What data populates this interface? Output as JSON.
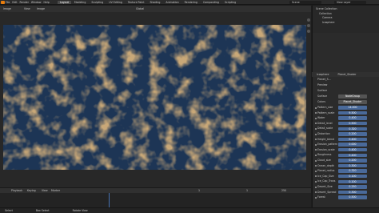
{
  "menu": {
    "items": [
      "File",
      "Edit",
      "Render",
      "Window",
      "Help"
    ]
  },
  "workspace_tabs": [
    "Layout",
    "Modeling",
    "Sculpting",
    "UV Editing",
    "Texture Paint",
    "Shading",
    "Animation",
    "Rendering",
    "Compositing",
    "Scripting"
  ],
  "scene_label": "Scene",
  "view_layer_label": "View Layer",
  "image_header": {
    "mode": "Image",
    "view": "View",
    "image": "Image",
    "global": "Global"
  },
  "outliner": {
    "rows": [
      "Scene Collection",
      "Collection",
      "Camera",
      "Icosphere"
    ]
  },
  "node_header": {
    "object": "Icosphere",
    "material": "Planet_Shader"
  },
  "properties": {
    "material_name": "Planet_Shader",
    "slot": "Planet_S...",
    "preview": "Preview",
    "surface_section": "Surface",
    "surface_label": "Surface",
    "surface_value": "NodeGroup",
    "color_label": "Colors",
    "color_value": "Planet_Shader",
    "rows": [
      {
        "label": "Pattern_size",
        "value": "14.000"
      },
      {
        "label": "Pattern_scale",
        "value": "9.500"
      },
      {
        "label": "Water",
        "value": "0.400"
      },
      {
        "label": "Detail_level",
        "value": "0.500"
      },
      {
        "label": "Detail_scale",
        "value": "0.320"
      },
      {
        "label": "Distortion",
        "value": "0.200"
      },
      {
        "label": "Height_blend",
        "value": "0.400"
      },
      {
        "label": "Erosion_pattern",
        "value": "0.000"
      },
      {
        "label": "Erosion_scale",
        "value": "0.400"
      },
      {
        "label": "Roughness",
        "value": "0.400"
      },
      {
        "label": "Cloud_size",
        "value": "0.200"
      },
      {
        "label": "Ocean_depth",
        "value": "0.300"
      },
      {
        "label": "Planet_radius",
        "value": "0.320"
      },
      {
        "label": "Ice_Cap_Size",
        "value": "0.100"
      },
      {
        "label": "Ice_Cap_Trans",
        "value": "0.100"
      },
      {
        "label": "Desert_Size",
        "value": "0.250"
      },
      {
        "label": "Desert_Spread",
        "value": "0.300"
      },
      {
        "label": "Forest",
        "value": "0.500"
      }
    ]
  },
  "timeline": {
    "playback": "Playback",
    "keying": "Keying",
    "view": "View",
    "marker": "Marker",
    "start": "1",
    "end": "250",
    "frame": "1"
  },
  "status": {
    "left": "Select",
    "mid": "Box Select",
    "right": "Rotate View"
  },
  "colors": {
    "accent": "#4772b3",
    "orange": "#e87d0d",
    "ocean": "#1d3555",
    "land": "#c9a878"
  }
}
